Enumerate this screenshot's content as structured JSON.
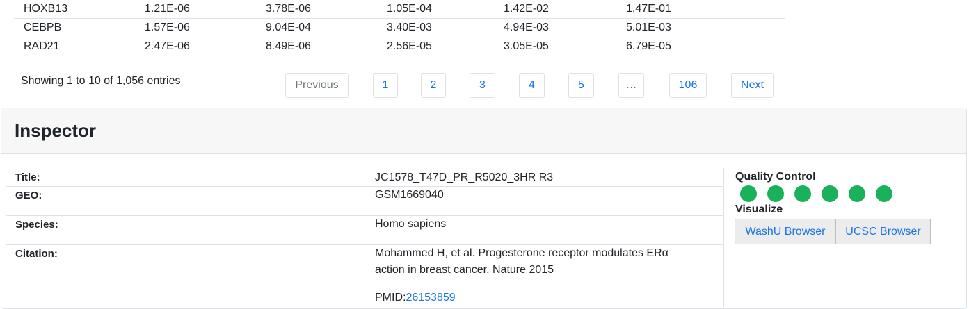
{
  "table": {
    "rows": [
      [
        "HOXB13",
        "1.21E-06",
        "3.78E-06",
        "1.05E-04",
        "1.42E-02",
        "1.47E-01"
      ],
      [
        "CEBPB",
        "1.57E-06",
        "9.04E-04",
        "3.40E-03",
        "4.94E-03",
        "5.01E-03"
      ],
      [
        "RAD21",
        "2.47E-06",
        "8.49E-06",
        "2.56E-05",
        "3.05E-05",
        "6.79E-05"
      ]
    ]
  },
  "pagination": {
    "info": "Showing 1 to 10 of 1,056 entries",
    "previous": "Previous",
    "pages": [
      "1",
      "2",
      "3",
      "4",
      "5",
      "…",
      "106"
    ],
    "next": "Next"
  },
  "inspector": {
    "title": "Inspector",
    "fields": {
      "title_label": "Title:",
      "title_value": "JC1578_T47D_PR_R5020_3HR R3",
      "geo_label": "GEO:",
      "geo_value": "GSM1669040",
      "species_label": "Species:",
      "species_value": "Homo sapiens",
      "citation_label": "Citation:",
      "citation_line1": "Mohammed H, et al. Progesterone receptor modulates ERα",
      "citation_line2": "action in breast cancer. Nature 2015",
      "pmid_label": "PMID:",
      "pmid_value": "26153859"
    },
    "quality_control": {
      "label": "Quality Control",
      "dot_color": "#19b25a",
      "dots": [
        "pass",
        "pass",
        "pass",
        "pass",
        "pass",
        "pass"
      ]
    },
    "visualize": {
      "label": "Visualize",
      "washu": "WashU Browser",
      "ucsc": "UCSC Browser"
    }
  }
}
